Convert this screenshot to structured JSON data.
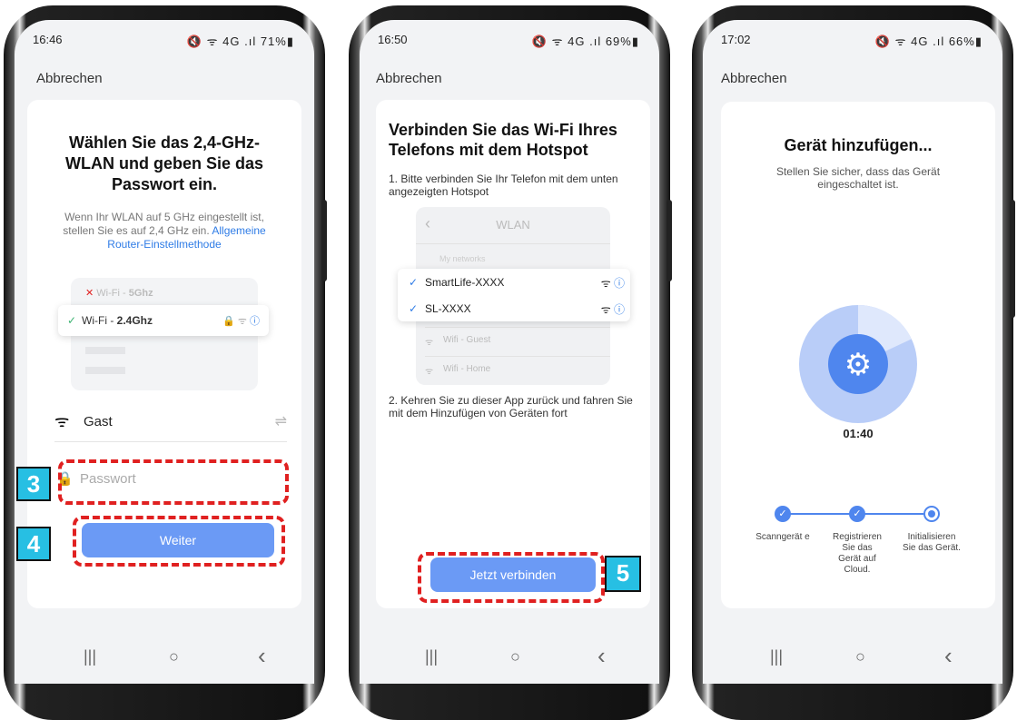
{
  "phone1": {
    "time": "16:46",
    "status_icons": "🔇 ᯤ 4G .ıl 71%▮",
    "cancel": "Abbrechen",
    "title": "Wählen Sie das 2,4-GHz-WLAN und geben Sie das Passwort ein.",
    "desc": "Wenn Ihr WLAN auf 5 GHz eingestellt ist, stellen Sie es auf 2,4 GHz ein.",
    "desc_link": "Allgemeine Router-Einstellmethode",
    "wifi5_prefix": "Wi-Fi - ",
    "wifi5_bold": "5Ghz",
    "wifi24_prefix": "Wi-Fi - ",
    "wifi24_bold": "2.4Ghz",
    "network_name": "Gast",
    "password_placeholder": "Passwort",
    "next_button": "Weiter",
    "badge3": "3",
    "badge4": "4"
  },
  "phone2": {
    "time": "16:50",
    "status_icons": "🔇 ᯤ 4G .ıl 69%▮",
    "cancel": "Abbrechen",
    "title": "Verbinden Sie das Wi-Fi Ihres Telefons mit dem Hotspot",
    "step1": "1. Bitte verbinden Sie Ihr Telefon mit dem unten angezeigten Hotspot",
    "wlan_header": "WLAN",
    "my_networks": "My networks",
    "net1": "SmartLife-XXXX",
    "net2": "SL-XXXX",
    "net3": "Wifi - Guest",
    "net4": "Wifi - Home",
    "step2": "2. Kehren Sie zu dieser App zurück und fahren Sie mit dem Hinzufügen von Geräten fort",
    "connect_button": "Jetzt verbinden",
    "badge5": "5"
  },
  "phone3": {
    "time": "17:02",
    "status_icons": "🔇 ᯤ 4G .ıl 66%▮",
    "cancel": "Abbrechen",
    "title": "Gerät hinzufügen...",
    "subtitle": "Stellen Sie sicher, dass das Gerät eingeschaltet ist.",
    "timer": "01:40",
    "progress_fraction": 0.18,
    "steps": [
      "Scanngerät e",
      "Registrieren Sie das Gerät auf Cloud.",
      "Initialisieren Sie das Gerät."
    ]
  },
  "nav": {
    "recent": "|||",
    "home": "○",
    "back": "‹"
  },
  "colors": {
    "accent": "#6b9af5",
    "link": "#2f7ce6",
    "dash": "#e02020",
    "badge": "#27bfe3"
  }
}
